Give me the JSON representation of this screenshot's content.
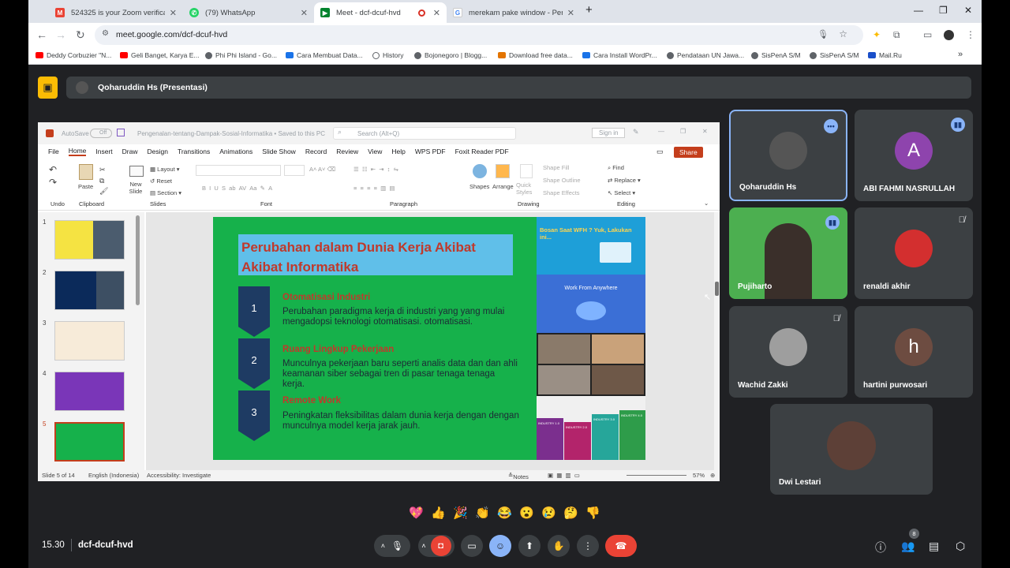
{
  "browser": {
    "tabs": [
      {
        "label": "524325 is your Zoom verificatio",
        "icon": "gmail-icon",
        "color": "#ea4335"
      },
      {
        "label": "(79) WhatsApp",
        "icon": "whatsapp-icon",
        "color": "#25d366"
      },
      {
        "label": "Meet - dcf-dcuf-hvd",
        "icon": "meet-icon",
        "color": "#00832d"
      },
      {
        "label": "merekam pake window - Penel",
        "icon": "google-icon",
        "color": "#4285f4"
      }
    ],
    "url": "meet.google.com/dcf-dcuf-hvd",
    "bookmarks": [
      {
        "label": "Deddy Corbuzier \"N...",
        "color": "#ff0000"
      },
      {
        "label": "Geli Banget, Karya E...",
        "color": "#ff0000"
      },
      {
        "label": "Phi Phi Island - Go...",
        "color": "#5f6368"
      },
      {
        "label": "Cara Membuat Data...",
        "color": "#1a73e8"
      },
      {
        "label": "History",
        "color": "#5f6368"
      },
      {
        "label": "Bojonegoro | Blogg...",
        "color": "#5f6368"
      },
      {
        "label": "Download free data...",
        "color": "#e37400"
      },
      {
        "label": "Cara Install WordPr...",
        "color": "#1a73e8"
      },
      {
        "label": "Pendataan UN Jawa...",
        "color": "#5f6368"
      },
      {
        "label": "SisPenA S/M",
        "color": "#5f6368"
      },
      {
        "label": "SisPenA S/M",
        "color": "#5f6368"
      },
      {
        "label": "Mail.Ru",
        "color": "#1a4fc9"
      }
    ]
  },
  "meet": {
    "presenter_label": "Qoharuddin Hs (Presentasi)",
    "time": "15.30",
    "meeting_code": "dcf-dcuf-hvd",
    "participant_count": "8",
    "reactions": [
      "💖",
      "👍",
      "🎉",
      "👏",
      "😂",
      "😮",
      "😢",
      "🤔",
      "👎"
    ],
    "participants": [
      {
        "name": "Qoharuddin Hs",
        "initial": "",
        "color": "#555555"
      },
      {
        "name": "ABI FAHMI NASRULLAH",
        "initial": "A",
        "color": "#8e44ad"
      },
      {
        "name": "Pujiharto",
        "initial": "",
        "color": "#4caf50"
      },
      {
        "name": "renaldi akhir",
        "initial": "",
        "color": "#d32f2f"
      },
      {
        "name": "Wachid Zakki",
        "initial": "",
        "color": "#9e9e9e"
      },
      {
        "name": "hartini purwosari",
        "initial": "h",
        "color": "#6d4c41"
      },
      {
        "name": "Dwi Lestari",
        "initial": "",
        "color": "#5d4037"
      }
    ]
  },
  "ppt": {
    "autosave": "AutoSave",
    "autosave_state": "Off",
    "doc_title": "Pengenalan-tentang-Dampak-Sosial-Informatika • Saved to this PC",
    "search_placeholder": "Search (Alt+Q)",
    "signin": "Sign in",
    "menu": [
      "File",
      "Home",
      "Insert",
      "Draw",
      "Design",
      "Transitions",
      "Animations",
      "Slide Show",
      "Record",
      "Review",
      "View",
      "Help",
      "WPS PDF",
      "Foxit Reader PDF"
    ],
    "share": "Share",
    "ribbon": {
      "undo": "Undo",
      "clipboard": "Clipboard",
      "paste": "Paste",
      "slides": "Slides",
      "new_slide": "New Slide",
      "layout": "Layout",
      "reset": "Reset",
      "section": "Section",
      "font": "Font",
      "paragraph": "Paragraph",
      "drawing": "Drawing",
      "shapes": "Shapes",
      "arrange": "Arrange",
      "quick_styles": "Quick Styles",
      "shape_fill": "Shape Fill",
      "shape_outline": "Shape Outline",
      "shape_effects": "Shape Effects",
      "editing": "Editing",
      "find": "Find",
      "replace": "Replace",
      "select": "Select"
    },
    "thumb_numbers": [
      "1",
      "2",
      "3",
      "4",
      "5"
    ],
    "slide": {
      "title": "Perubahan dalam Dunia Kerja Akibat Akibat Informatika",
      "items": [
        {
          "num": "1",
          "head": "Otomatisasi Industri",
          "body": "Perubahan paradigma kerja di industri yang yang mulai mengadopsi teknologi otomatisasi. otomatisasi."
        },
        {
          "num": "2",
          "head": "Ruang Lingkup Pekerjaan",
          "body": "Munculnya pekerjaan baru seperti analis data dan dan ahli keamanan siber sebagai tren di pasar tenaga tenaga kerja."
        },
        {
          "num": "3",
          "head": "Remote Work",
          "body": "Peningkatan fleksibilitas dalam dunia kerja dengan dengan munculnya model kerja jarak jauh."
        }
      ],
      "img1_text": "Bosan Saat WFH ? Yuk, Lakukan ini...",
      "img2_text": "Work From Anywhere",
      "industry": [
        "INDUSTRY 1.0",
        "INDUSTRY 2.0",
        "INDUSTRY 3.0",
        "INDUSTRY 4.0"
      ]
    },
    "status": {
      "slide_of": "Slide 5 of 14",
      "language": "English (Indonesia)",
      "accessibility": "Accessibility: Investigate",
      "notes": "Notes",
      "zoom": "57%"
    }
  }
}
